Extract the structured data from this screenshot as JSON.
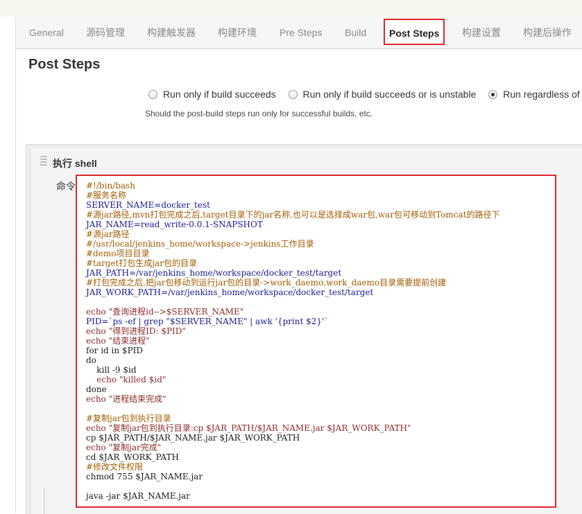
{
  "tabs": [
    {
      "label": "General"
    },
    {
      "label": "源码管理"
    },
    {
      "label": "构建触发器"
    },
    {
      "label": "构建环境"
    },
    {
      "label": "Pre Steps"
    },
    {
      "label": "Build"
    },
    {
      "label": "Post Steps"
    },
    {
      "label": "构建设置"
    },
    {
      "label": "构建后操作"
    }
  ],
  "post_steps": {
    "title": "Post Steps",
    "options": [
      {
        "label": "Run only if build succeeds",
        "checked": false
      },
      {
        "label": "Run only if build succeeds or is unstable",
        "checked": false
      },
      {
        "label": "Run regardless of bu",
        "checked": true
      }
    ],
    "hint": "Should the post-build steps run only for successful builds, etc."
  },
  "shell_step": {
    "title": "执行 shell",
    "command_label": "命令",
    "lines": [
      "#!/bin/bash",
      "#服务名称",
      "SERVER_NAME=docker_test",
      "#源jar路径,mvn打包完成之后,target目录下的jar名称,也可以是选择成war包,war包可移动到Tomcat的路径下",
      "JAR_NAME=read_write-0.0.1-SNAPSHOT",
      "#源jar路径",
      "#/usr/local/jenkins_home/workspace->jenkins工作目录",
      "#demo项目目录",
      "#target打包生成jar包的目录",
      "JAR_PATH=/var/jenkins_home/workspace/docker_test/target",
      "#打包完成之后,把jar包移动到运行jar包的目录->work_daemo,work_daemo目录需要提前创建",
      "JAR_WORK_PATH=/var/jenkins_home/workspace/docker_test/target",
      "",
      "echo \"查询进程id-->$SERVER_NAME\"",
      "PID=`ps -ef | grep \"$SERVER_NAME\" | awk '{print $2}'`",
      "echo \"得到进程ID: $PID\"",
      "echo \"结束进程\"",
      "for id in $PID",
      "do",
      "    kill -9 $id",
      "    echo \"killed $id\"",
      "done",
      "echo \"进程结束完成\"",
      "",
      "#复制jar包到执行目录",
      "echo \"复制jar包到执行目录:cp $JAR_PATH/$JAR_NAME.jar $JAR_WORK_PATH\"",
      "cp $JAR_PATH/$JAR_NAME.jar $JAR_WORK_PATH",
      "echo \"复制jar完成\"",
      "cd $JAR_WORK_PATH",
      "#修改文件权限",
      "chmod 755 $JAR_NAME.jar",
      "",
      "java -jar $JAR_NAME.jar"
    ]
  }
}
